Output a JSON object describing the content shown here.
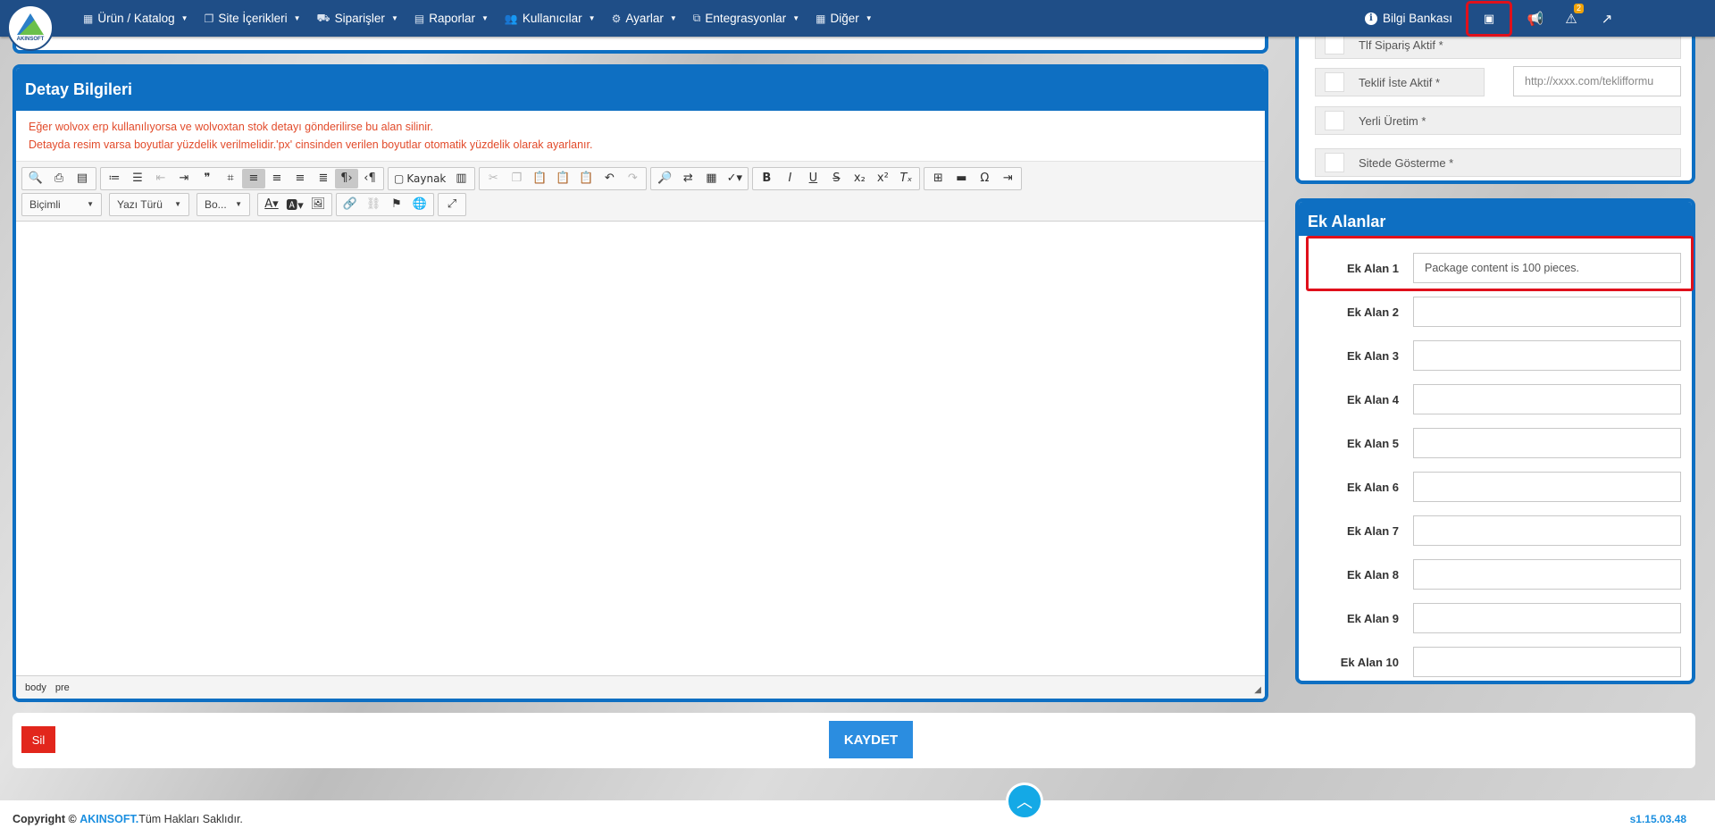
{
  "nav": {
    "logo_text": "AKINSOFT",
    "menu": [
      {
        "label": "Ürün / Katalog",
        "icon": "cubes-icon",
        "glyph": "▦"
      },
      {
        "label": "Site İçerikleri",
        "icon": "files-icon",
        "glyph": "❐"
      },
      {
        "label": "Siparişler",
        "icon": "truck-icon",
        "glyph": "⛟"
      },
      {
        "label": "Raporlar",
        "icon": "file-icon",
        "glyph": "▤"
      },
      {
        "label": "Kullanıcılar",
        "icon": "users-icon",
        "glyph": "👥"
      },
      {
        "label": "Ayarlar",
        "icon": "gears-icon",
        "glyph": "⚙"
      },
      {
        "label": "Entegrasyonlar",
        "icon": "sitemap-icon",
        "glyph": "⧉"
      },
      {
        "label": "Diğer",
        "icon": "grid-icon",
        "glyph": "▦"
      }
    ],
    "knowledge_base": "Bilgi Bankası",
    "alert_count": "2"
  },
  "detay": {
    "title": "Detay Bilgileri",
    "notice_1": "Eğer wolvox erp kullanılıyorsa ve wolvoxtan stok detayı gönderilirse bu alan silinir.",
    "notice_2": "Detayda resim varsa boyutlar yüzdelik verilmelidir.'px' cinsinden verilen boyutlar otomatik yüzdelik olarak ayarlanır.",
    "source_label": "Kaynak",
    "format_select": "Biçimli",
    "font_select": "Yazı Türü",
    "size_select": "Bo...",
    "status_path": [
      "body",
      "pre"
    ]
  },
  "right_top": {
    "row1": "Tlf Sipariş Aktif *",
    "row2": "Teklif İste Aktif *",
    "row2_url_placeholder": "http://xxxx.com/teklifformu",
    "row3": "Yerli Üretim *",
    "row4": "Sitede Gösterme *"
  },
  "ek": {
    "title": "Ek Alanlar",
    "fields": [
      {
        "label": "Ek Alan 1",
        "value": "Package content is 100 pieces."
      },
      {
        "label": "Ek Alan 2",
        "value": ""
      },
      {
        "label": "Ek Alan 3",
        "value": ""
      },
      {
        "label": "Ek Alan 4",
        "value": ""
      },
      {
        "label": "Ek Alan 5",
        "value": ""
      },
      {
        "label": "Ek Alan 6",
        "value": ""
      },
      {
        "label": "Ek Alan 7",
        "value": ""
      },
      {
        "label": "Ek Alan 8",
        "value": ""
      },
      {
        "label": "Ek Alan 9",
        "value": ""
      },
      {
        "label": "Ek Alan 10",
        "value": ""
      }
    ]
  },
  "actions": {
    "delete": "Sil",
    "save": "KAYDET"
  },
  "footer": {
    "copyright": "Copyright ©",
    "brand": "AKINSOFT.",
    "rights": "Tüm Hakları Saklıdır.",
    "version": "s1.15.03.48"
  }
}
